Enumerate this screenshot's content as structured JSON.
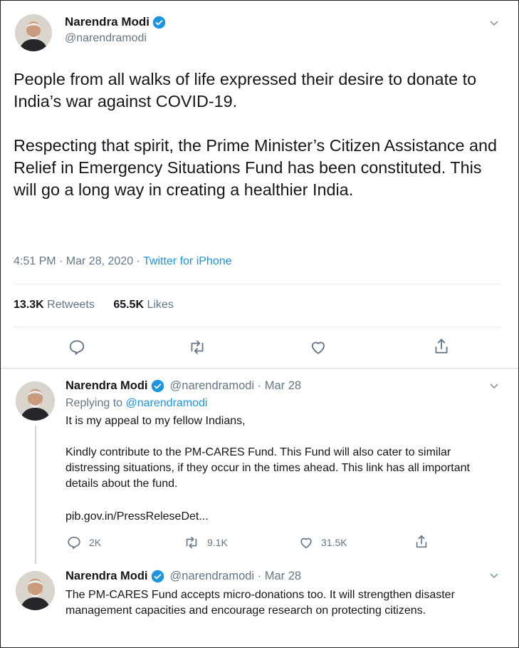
{
  "main_tweet": {
    "author_name": "Narendra Modi",
    "handle": "@narendramodi",
    "paragraphs": [
      "People from all walks of life expressed their desire to donate to India’s war against COVID-19.",
      "Respecting that spirit, the Prime Minister’s Citizen Assistance and Relief in Emergency Situations Fund has been constituted. This will go a long way in creating a healthier India."
    ],
    "timestamp": "4:51 PM · Mar 28, 2020 ·",
    "source": "Twitter for iPhone",
    "retweets_count": "13.3K",
    "retweets_label": "Retweets",
    "likes_count": "65.5K",
    "likes_label": "Likes"
  },
  "reply_1": {
    "author_name": "Narendra Modi",
    "handle_date": "@narendramodi · Mar 28",
    "replying_prefix": "Replying to",
    "replying_handle": "@narendramodi",
    "lines": [
      "It is my appeal to my fellow Indians,",
      "Kindly contribute to the PM-CARES Fund. This Fund will also cater to similar distressing situations, if they occur in the times ahead. This link has all important details about the fund."
    ],
    "link": "pib.gov.in/PressReleseDet...",
    "reply_count": "2K",
    "retweet_count": "9.1K",
    "like_count": "31.5K"
  },
  "reply_2": {
    "author_name": "Narendra Modi",
    "handle_date": "@narendramodi · Mar 28",
    "text": "The PM-CARES Fund accepts micro-donations too. It will strengthen disaster management capacities and encourage research on protecting citizens."
  },
  "colors": {
    "accent": "#1b95e0",
    "text": "#14171a",
    "muted": "#657786",
    "divider": "#e6ecf0"
  },
  "icons": [
    "verified-badge-icon",
    "chevron-down-icon",
    "reply-icon",
    "retweet-icon",
    "like-icon",
    "share-icon"
  ]
}
